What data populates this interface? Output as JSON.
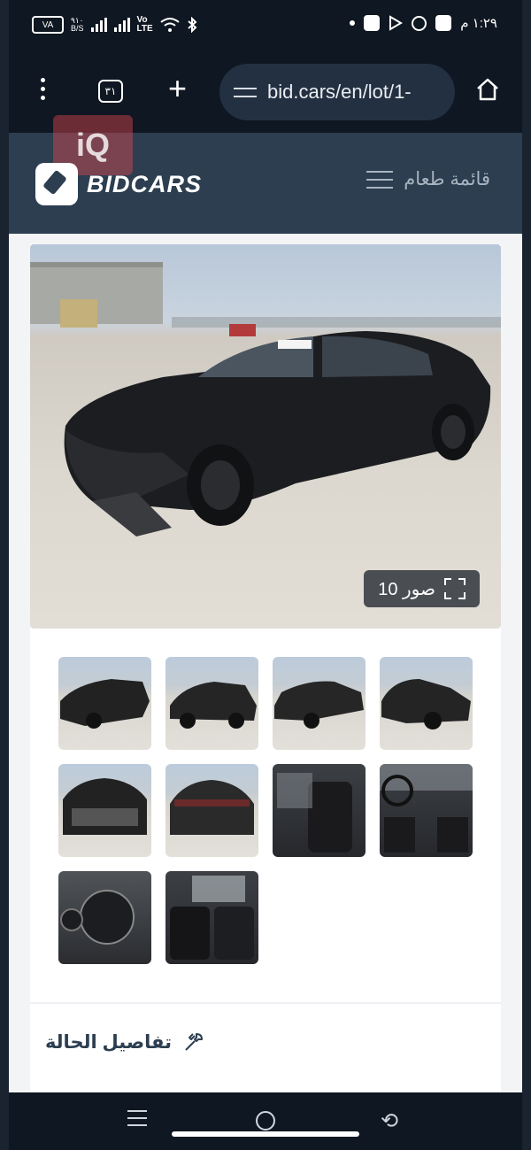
{
  "status_bar": {
    "battery": "VA",
    "net_speed_top": "٩١٠",
    "net_speed_bottom": "B/S",
    "volte_top": "Vo",
    "volte_bottom": "LTE",
    "time": "١:٢٩ م"
  },
  "browser": {
    "tab_count": "٣١",
    "url": "bid.cars/en/lot/1-"
  },
  "header": {
    "logo_text": "BIDCARS",
    "watermark": "iQ",
    "menu_label": "قائمة طعام"
  },
  "gallery": {
    "photo_count_label": "صور 10",
    "thumbnails": [
      {
        "subject": "front-left exterior"
      },
      {
        "subject": "left side exterior"
      },
      {
        "subject": "rear-left exterior"
      },
      {
        "subject": "front-right exterior"
      },
      {
        "subject": "front damage close-up"
      },
      {
        "subject": "rear exterior"
      },
      {
        "subject": "driver seat interior"
      },
      {
        "subject": "dashboard interior"
      },
      {
        "subject": "instrument cluster"
      },
      {
        "subject": "rear seats interior"
      }
    ]
  },
  "condition": {
    "label": "تفاصيل الحالة",
    "icon": "wrench-icon"
  },
  "colors": {
    "header_bg": "#2c3e50",
    "browser_bg": "#0f1722",
    "accent_watermark": "#dc4650"
  }
}
